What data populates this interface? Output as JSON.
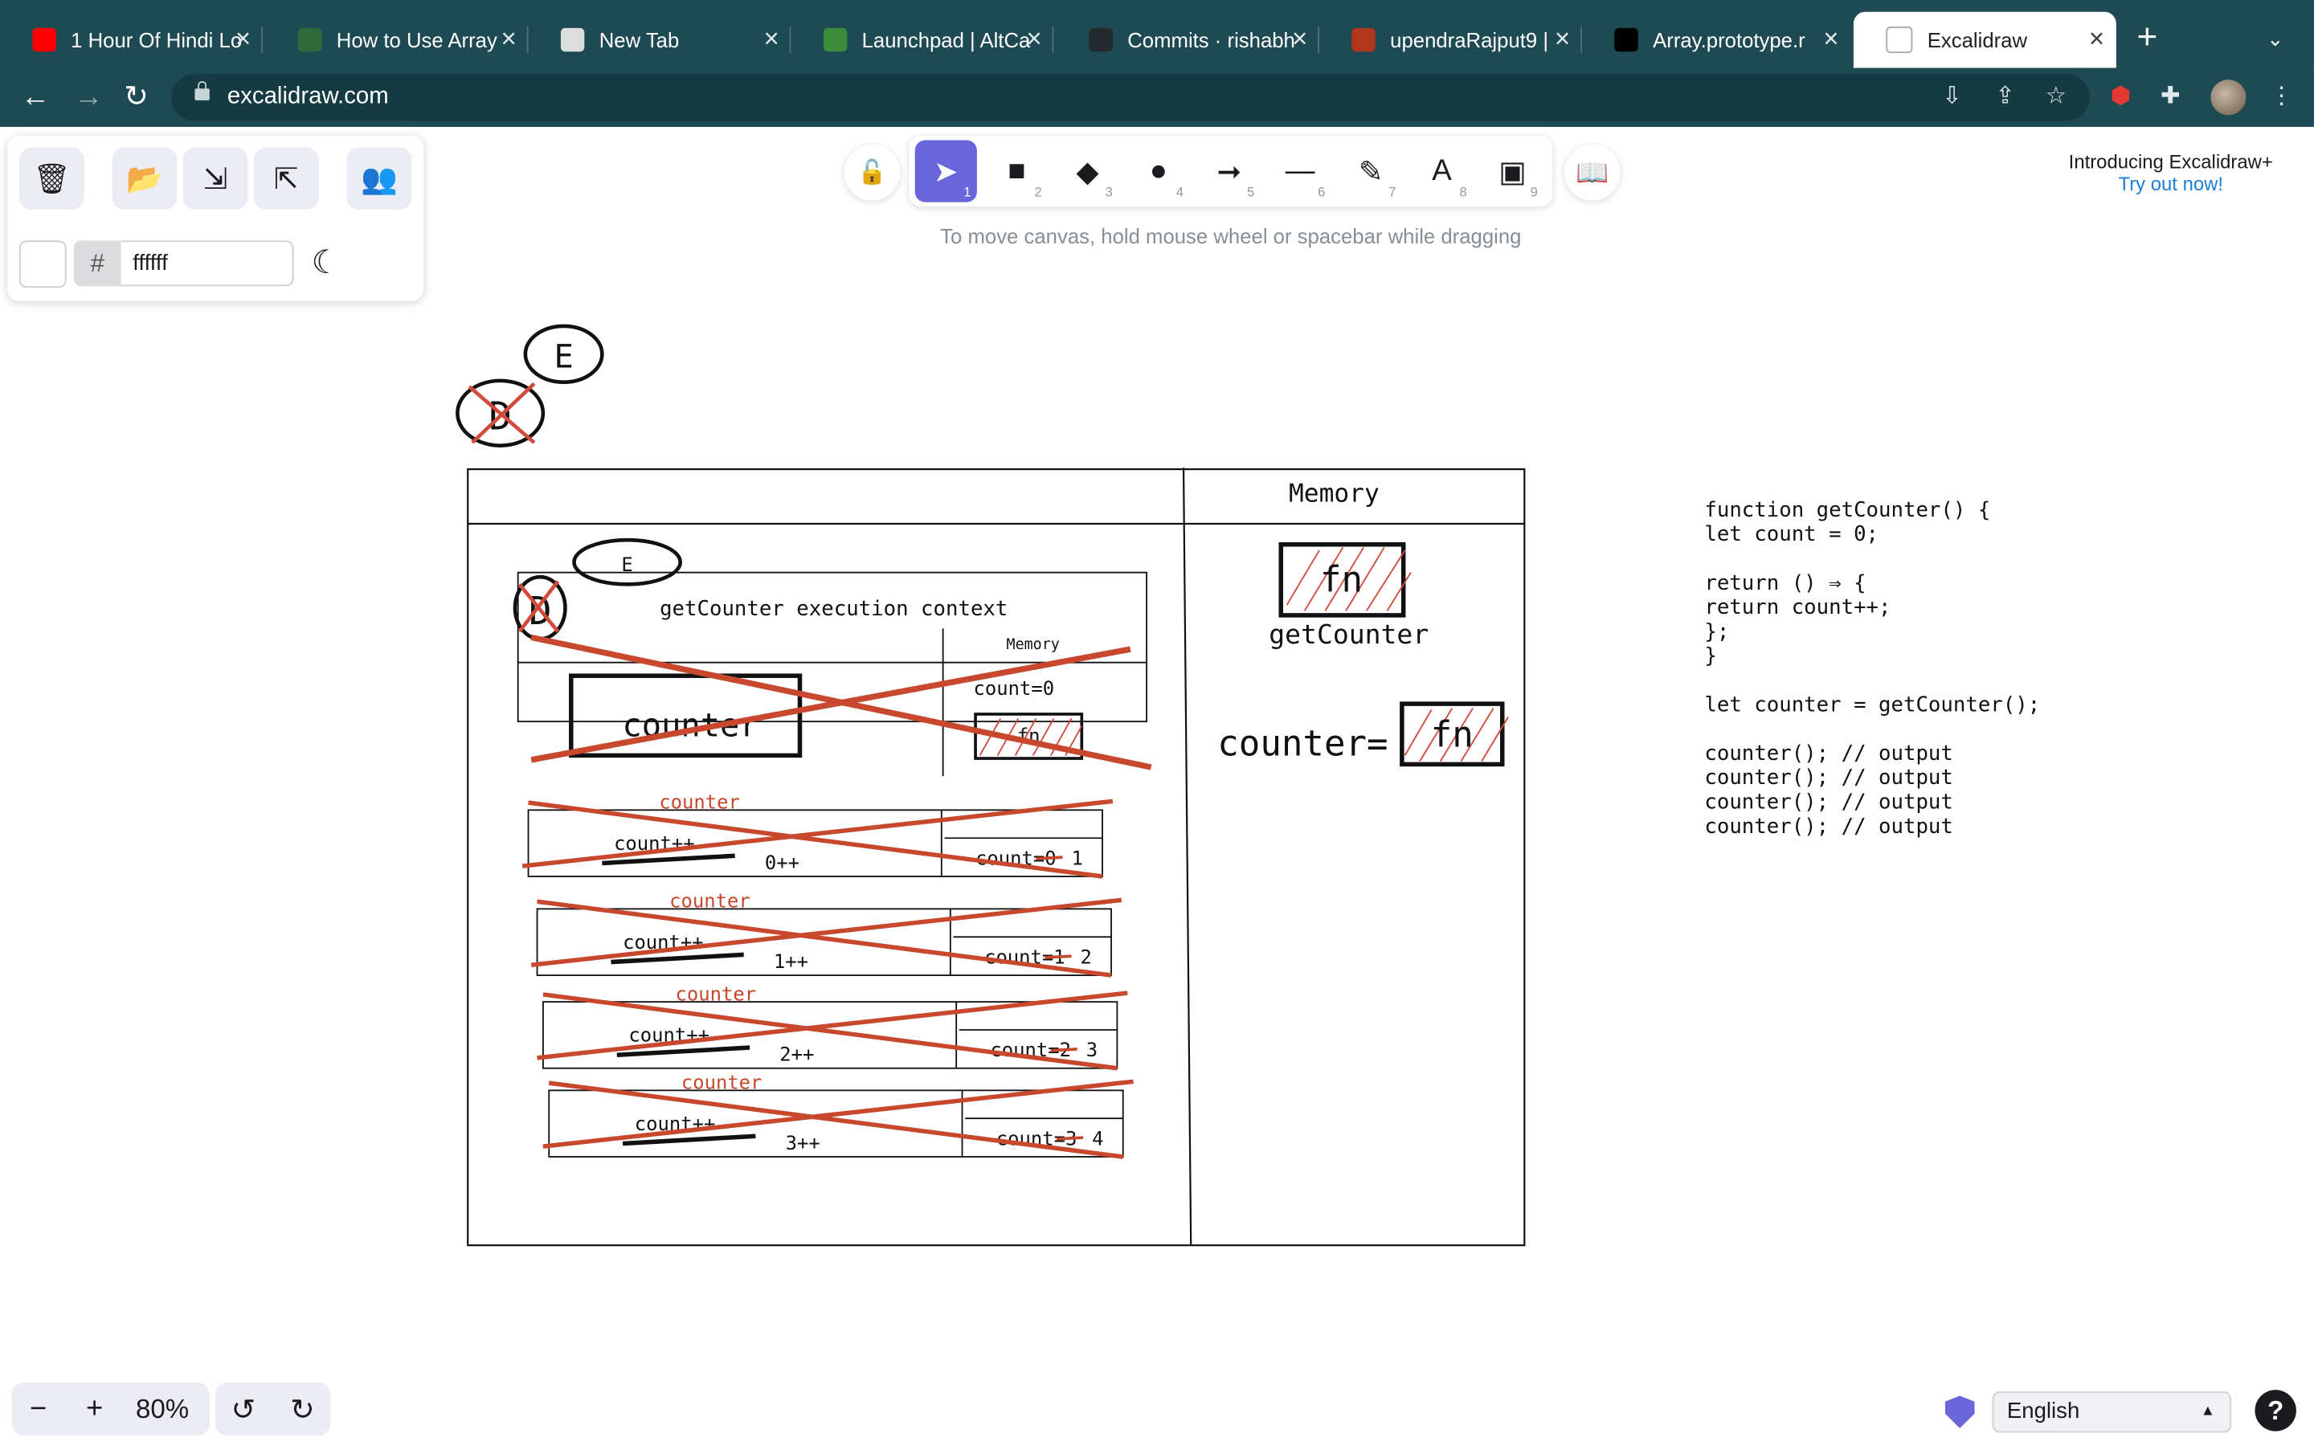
{
  "browser": {
    "tabs": [
      {
        "title": "1 Hour Of Hindi Lo",
        "icon": "youtube-icon",
        "color": "#ff0000"
      },
      {
        "title": "How to Use Array",
        "icon": "dp-icon",
        "color": "#2f6b3a"
      },
      {
        "title": "New Tab",
        "icon": "chrome-icon",
        "color": "#dddddd"
      },
      {
        "title": "Launchpad | AltCa",
        "icon": "altcampus-icon",
        "color": "#3a8c3a"
      },
      {
        "title": "Commits · rishabh",
        "icon": "github-icon",
        "color": "#24292e"
      },
      {
        "title": "upendraRajput9 |",
        "icon": "codewars-icon",
        "color": "#b1361e"
      },
      {
        "title": "Array.prototype.r",
        "icon": "mdn-icon",
        "color": "#000000"
      },
      {
        "title": "Excalidraw",
        "icon": "excalidraw-icon",
        "color": "#ffffff"
      }
    ],
    "url": "excalidraw.com"
  },
  "menu": {
    "color_hash": "#",
    "color_value": "ffffff"
  },
  "toolbar": {
    "tools": [
      {
        "name": "selection",
        "key": "1",
        "glyph": "➤"
      },
      {
        "name": "rectangle",
        "key": "2",
        "glyph": "■"
      },
      {
        "name": "diamond",
        "key": "3",
        "glyph": "◆"
      },
      {
        "name": "ellipse",
        "key": "4",
        "glyph": "●"
      },
      {
        "name": "arrow",
        "key": "5",
        "glyph": "➞"
      },
      {
        "name": "line",
        "key": "6",
        "glyph": "—"
      },
      {
        "name": "draw",
        "key": "7",
        "glyph": "✎"
      },
      {
        "name": "text",
        "key": "8",
        "glyph": "A"
      },
      {
        "name": "image",
        "key": "9",
        "glyph": "▣"
      }
    ],
    "hint": "To move canvas, hold mouse wheel or spacebar while dragging"
  },
  "promo": {
    "line1": "Introducing Excalidraw+",
    "line2": "Try out now!"
  },
  "canvas": {
    "circle_e": "E",
    "circle_d": "D",
    "memory_heading": "Memory",
    "fn_label": "fn",
    "get_counter_label": "getCounter",
    "counter_eq": "counter=",
    "context_e": "E",
    "context_d": "D",
    "context_title": "getCounter execution context",
    "context_memory": "Memory",
    "context_count": "count=0",
    "context_counter": "counter",
    "context_fn": "fn",
    "calls": [
      {
        "label": "counter",
        "body": "count++",
        "expr": "0++",
        "mem_old": "count=0",
        "mem_new": "1"
      },
      {
        "label": "counter",
        "body": "count++",
        "expr": "1++",
        "mem_old": "count=1",
        "mem_new": "2"
      },
      {
        "label": "counter",
        "body": "count++",
        "expr": "2++",
        "mem_old": "count=2",
        "mem_new": "3"
      },
      {
        "label": "counter",
        "body": "count++",
        "expr": "3++",
        "mem_old": "count=3",
        "mem_new": "4"
      }
    ],
    "code": [
      "function getCounter() {",
      "  let count = 0;",
      "",
      "  return () ⇒ {",
      "    return count++;",
      "  };",
      "}",
      "",
      "let counter = getCounter();",
      "",
      "counter(); // output",
      "counter(); // output",
      "counter(); // output",
      "counter(); // output"
    ]
  },
  "footer": {
    "zoom": "80%",
    "language": "English"
  }
}
